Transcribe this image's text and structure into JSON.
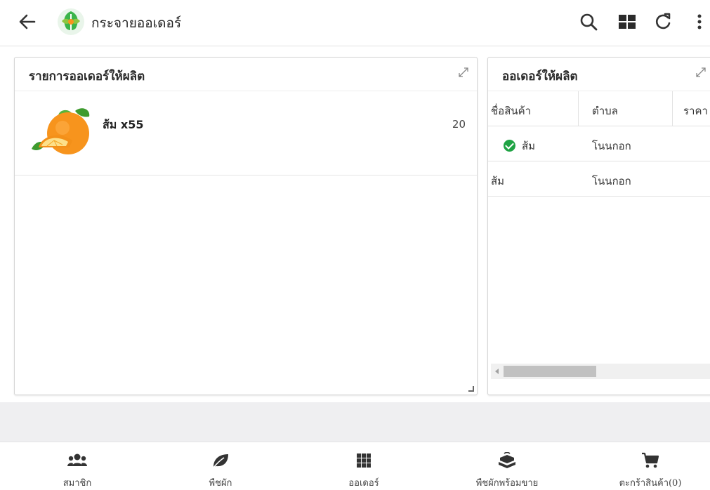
{
  "appbar": {
    "title": "กระจายออเดอร์",
    "icons": [
      "back-arrow-icon",
      "app-logo-icon",
      "search-icon",
      "grid-view-icon",
      "refresh-icon",
      "more-vert-icon"
    ]
  },
  "left_panel": {
    "title": "รายการออเดอร์ให้ผลิต",
    "items": [
      {
        "name": "ส้ม x55",
        "qty": "20",
        "image": "orange-fruit-image"
      }
    ]
  },
  "right_panel": {
    "title": "ออเดอร์ให้ผลิต",
    "columns": [
      "ชื่อสินค้า",
      "ตำบล",
      "ราคา"
    ],
    "rows": [
      {
        "product": "ส้ม",
        "subdistrict": "โนนกอก",
        "checked": true
      },
      {
        "product": "ส้ม",
        "subdistrict": "โนนกอก",
        "checked": false
      }
    ]
  },
  "bottom_nav": {
    "items": [
      {
        "label": "สมาชิก",
        "icon": "members-icon"
      },
      {
        "label": "พืชผัก",
        "icon": "leaf-icon"
      },
      {
        "label": "ออเดอร์",
        "icon": "grid-icon"
      },
      {
        "label": "พืชผักพร้อมขาย",
        "icon": "produce-ready-icon"
      },
      {
        "label": "ตะกร้าสินค้า(0)",
        "icon": "cart-icon"
      }
    ]
  },
  "colors": {
    "check_green": "#1fa344",
    "logo_green": "#3bb44a",
    "orange": "#f7941d"
  }
}
